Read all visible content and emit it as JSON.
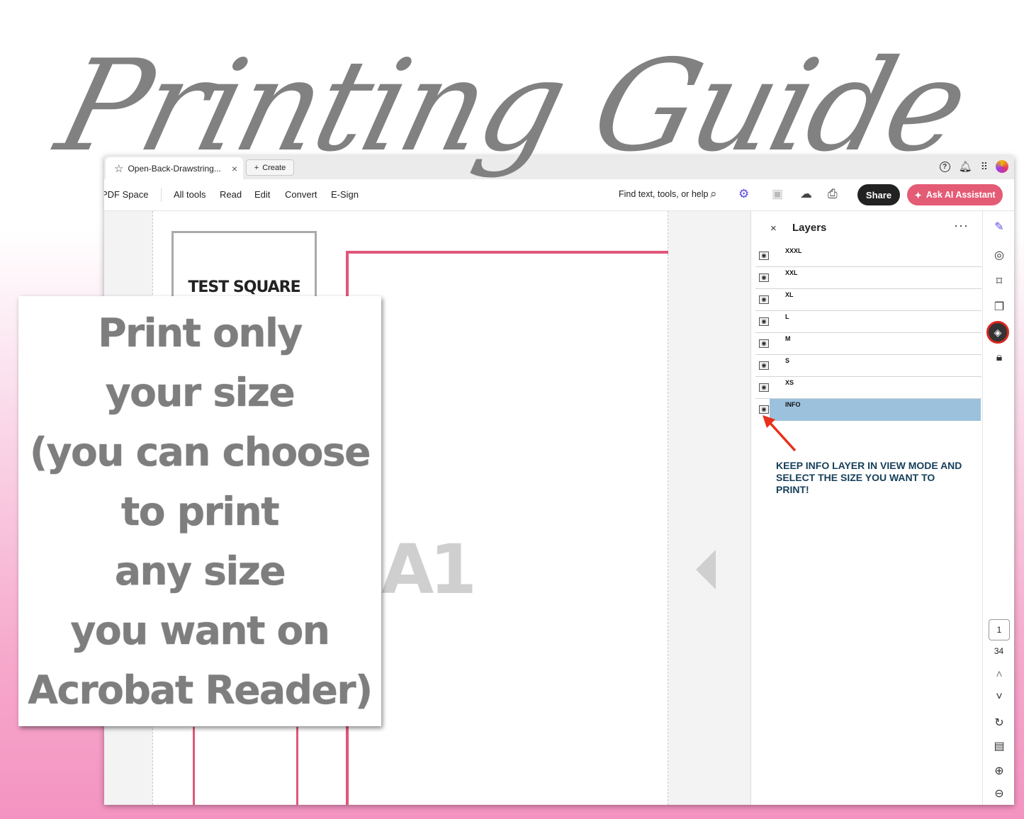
{
  "headline": "Printing Guide",
  "app": {
    "tab_title": "Open-Back-Drawstring...",
    "create_label": "Create",
    "menu": [
      "PDF Space",
      "All tools",
      "Read",
      "Edit",
      "Convert",
      "E-Sign"
    ],
    "search_placeholder": "Find text, tools, or help",
    "share_label": "Share",
    "ai_label": "Ask AI Assistant"
  },
  "document": {
    "test_square_label": "TEST SQUARE",
    "page_label": "A1"
  },
  "layers": {
    "title": "Layers",
    "items": [
      "XXXL",
      "XXL",
      "XL",
      "L",
      "M",
      "S",
      "XS",
      "INFO"
    ],
    "selected": "INFO",
    "note": "KEEP INFO LAYER IN VIEW MODE AND SELECT THE SIZE YOU WANT TO PRINT!"
  },
  "pager": {
    "current": "1",
    "total": "34"
  },
  "callout_lines": [
    "Print only",
    "your size",
    "(you can choose",
    "to print",
    "any size",
    "you want on",
    "Acrobat Reader)"
  ],
  "colors": {
    "accent_share": "#222222",
    "accent_ai": "#e45b75",
    "selected_layer": "#9bc1dd",
    "highlight_ring": "#d8261e",
    "pattern_line": "#e0577a"
  }
}
